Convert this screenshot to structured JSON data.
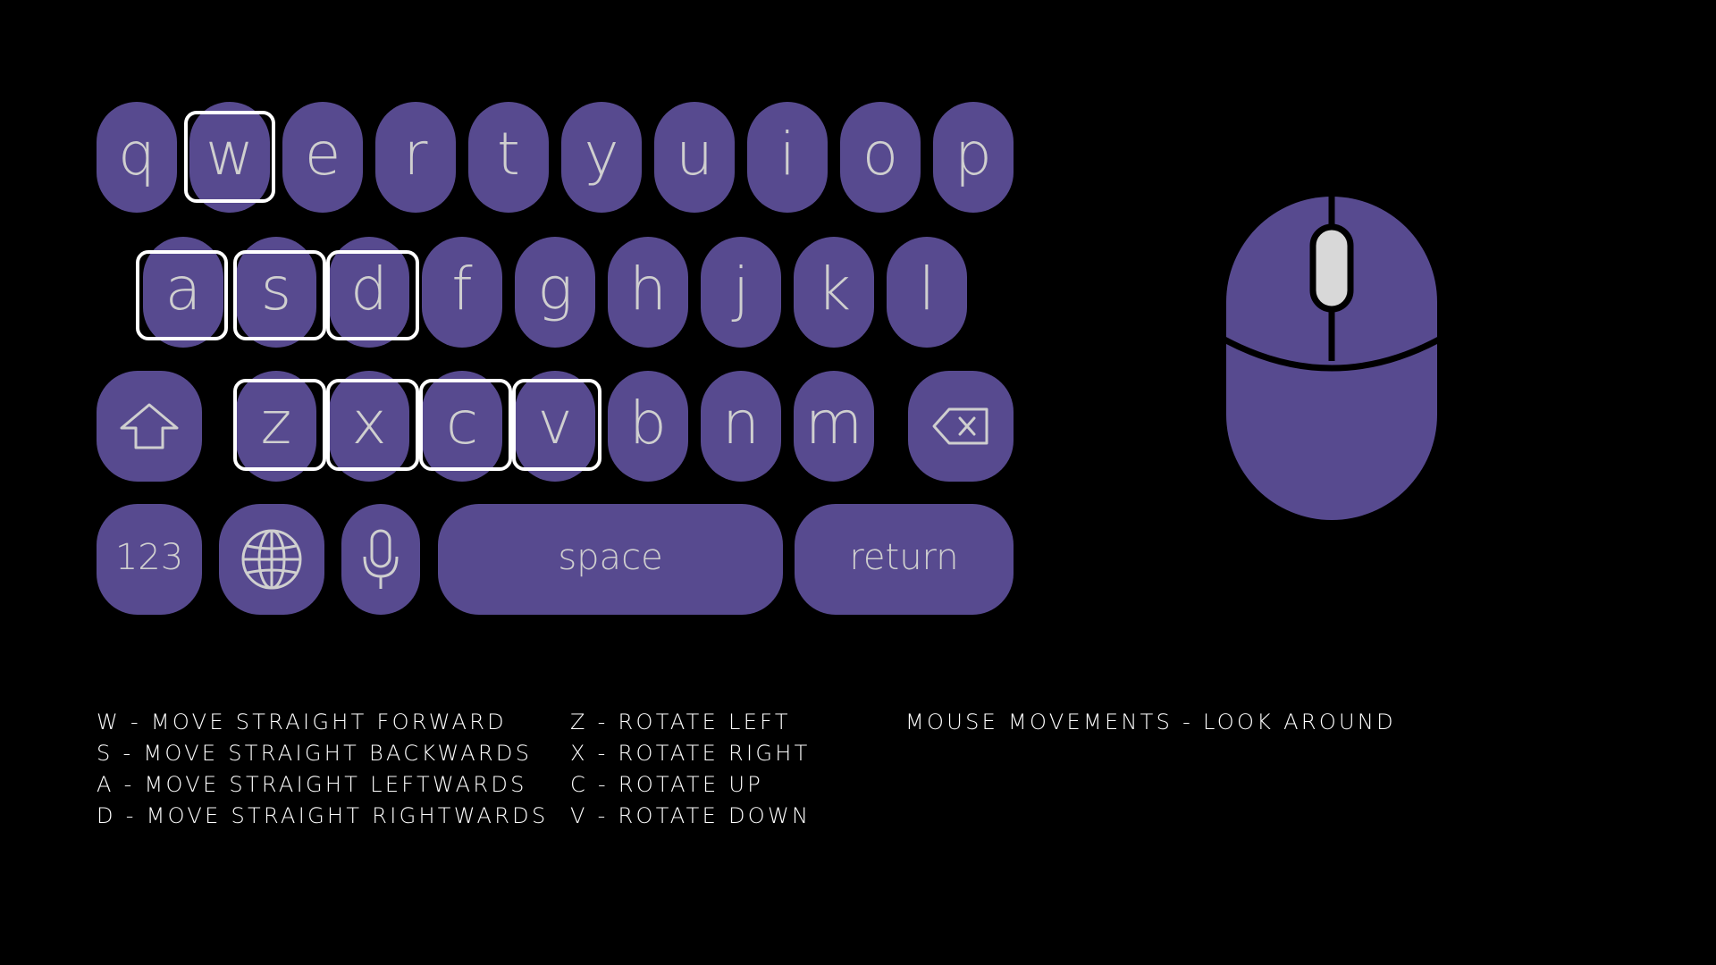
{
  "keyboard": {
    "row1": [
      "q",
      "w",
      "e",
      "r",
      "t",
      "y",
      "u",
      "i",
      "o",
      "p"
    ],
    "row2": [
      "a",
      "s",
      "d",
      "f",
      "g",
      "h",
      "j",
      "k",
      "l"
    ],
    "row3": [
      "z",
      "x",
      "c",
      "v",
      "b",
      "n",
      "m"
    ],
    "numbers_label": "123",
    "space_label": "space",
    "return_label": "return",
    "highlighted_keys": [
      "w",
      "a",
      "s",
      "d",
      "z",
      "x",
      "c",
      "v"
    ]
  },
  "icons": {
    "shift": "shift-arrow-icon",
    "backspace": "backspace-icon",
    "globe": "globe-icon",
    "microphone": "microphone-icon",
    "mouse": "computer-mouse-icon"
  },
  "colors": {
    "background": "#000000",
    "key_fill": "#574a8f",
    "key_text": "#cfcfcf",
    "highlight_border": "#ffffff",
    "legend_text": "#ffffff"
  },
  "legend": {
    "movement": [
      "W - MOVE STRAIGHT FORWARD",
      "S - MOVE STRAIGHT BACKWARDS",
      "A - MOVE STRAIGHT LEFTWARDS",
      "D - MOVE STRAIGHT RIGHTWARDS"
    ],
    "rotation": [
      "Z - ROTATE LEFT",
      "X - ROTATE RIGHT",
      "C - ROTATE UP",
      "V - ROTATE DOWN"
    ],
    "mouse": [
      "MOUSE MOVEMENTS - LOOK AROUND"
    ]
  }
}
